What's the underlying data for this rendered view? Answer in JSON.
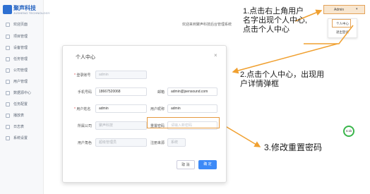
{
  "brand": {
    "name": "聚声科技",
    "sub": "JUSHENG TECHNOLOGY"
  },
  "sidebar": {
    "items": [
      {
        "label": "欢迎页面"
      },
      {
        "label": "项目管理"
      },
      {
        "label": "设备管理"
      },
      {
        "label": "任务管理"
      },
      {
        "label": "公司管理"
      },
      {
        "label": "用户管理"
      },
      {
        "label": "数据源中心"
      },
      {
        "label": "任务配置"
      },
      {
        "label": "播放表"
      },
      {
        "label": "日志表"
      },
      {
        "label": "系统设置"
      }
    ]
  },
  "header": {
    "welcome": "欢迎来到聚声科技后台管理系统",
    "user": {
      "name": "Admin",
      "caret": "▾"
    },
    "dropdown": [
      {
        "label": "个人中心"
      },
      {
        "label": "退出登录"
      }
    ]
  },
  "annotations": {
    "step1_line1": "1.点击右上角用户",
    "step1_line2": "名字出现个人中心,",
    "step1_line3": "点击个人中心",
    "step2_line1": "2.点击个人中心，出现用",
    "step2_line2": "户详情弹框",
    "step3": "3.修改重置密码"
  },
  "modal": {
    "title": "个人中心",
    "close": "×",
    "fields": {
      "account_label": "登录账号",
      "account_value": "admin",
      "phone_label": "手机号码",
      "phone_value": "18667520068",
      "email_label": "邮箱",
      "email_value": "admin@jsensound.com",
      "username_label": "用户姓名",
      "username_value": "admin",
      "nickname_label": "用户昵称",
      "nickname_value": "admin",
      "company_label": "所属公司",
      "company_value": "聚声科技",
      "reset_pwd_label": "重置密码",
      "reset_pwd_placeholder": "请输入新密码",
      "role_label": "用户角色",
      "role_value": "超级管理员",
      "source_label": "注册来源",
      "source_value": "系统"
    },
    "cancel": "取 消",
    "ok": "确 定"
  },
  "badge": {
    "text": "4.1k"
  },
  "colors": {
    "accent": "#3d8af7",
    "highlight": "#e69a3f"
  }
}
